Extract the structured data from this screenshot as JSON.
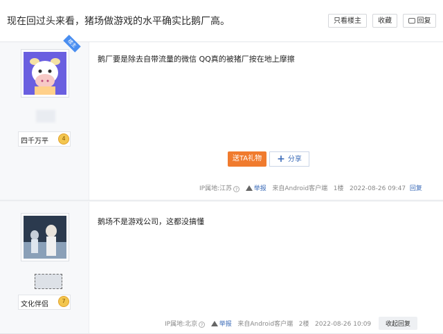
{
  "header": {
    "title": "现在回过头来看，猪场做游戏的水平确实比鹅厂高。",
    "only_op_label": "只看楼主",
    "favorite_label": "收藏",
    "reply_label": "回复"
  },
  "posts": [
    {
      "op_badge": "楼主",
      "username": "四千万平",
      "level": "4",
      "content": "鹅厂要是除去自带流量的微信 QQ真的被猪厂按在地上摩擦",
      "gift_label": "送TA礼物",
      "share_label": "分享",
      "ip": "IP属地:江苏",
      "report": "举报",
      "source": "来自Android客户端",
      "floor": "1楼",
      "time": "2022-08-26 09:47",
      "reply": "回复"
    },
    {
      "username": "文化伴侣",
      "level": "7",
      "content": "鹅场不是游戏公司，这都没搞懂",
      "ip": "IP属地:北京",
      "report": "举报",
      "source": "来自Android客户端",
      "floor": "2楼",
      "time": "2022-08-26 10:09",
      "reply": "收起回复"
    }
  ],
  "colors": {
    "accent": "#3b6bb8",
    "gift": "#f07b2e",
    "op_badge": "#4a8ef0",
    "level_badge": "#f3c64f"
  },
  "icons": [
    "reply-icon",
    "warning-icon",
    "question-icon",
    "plus-icon",
    "level-badge-icon"
  ]
}
